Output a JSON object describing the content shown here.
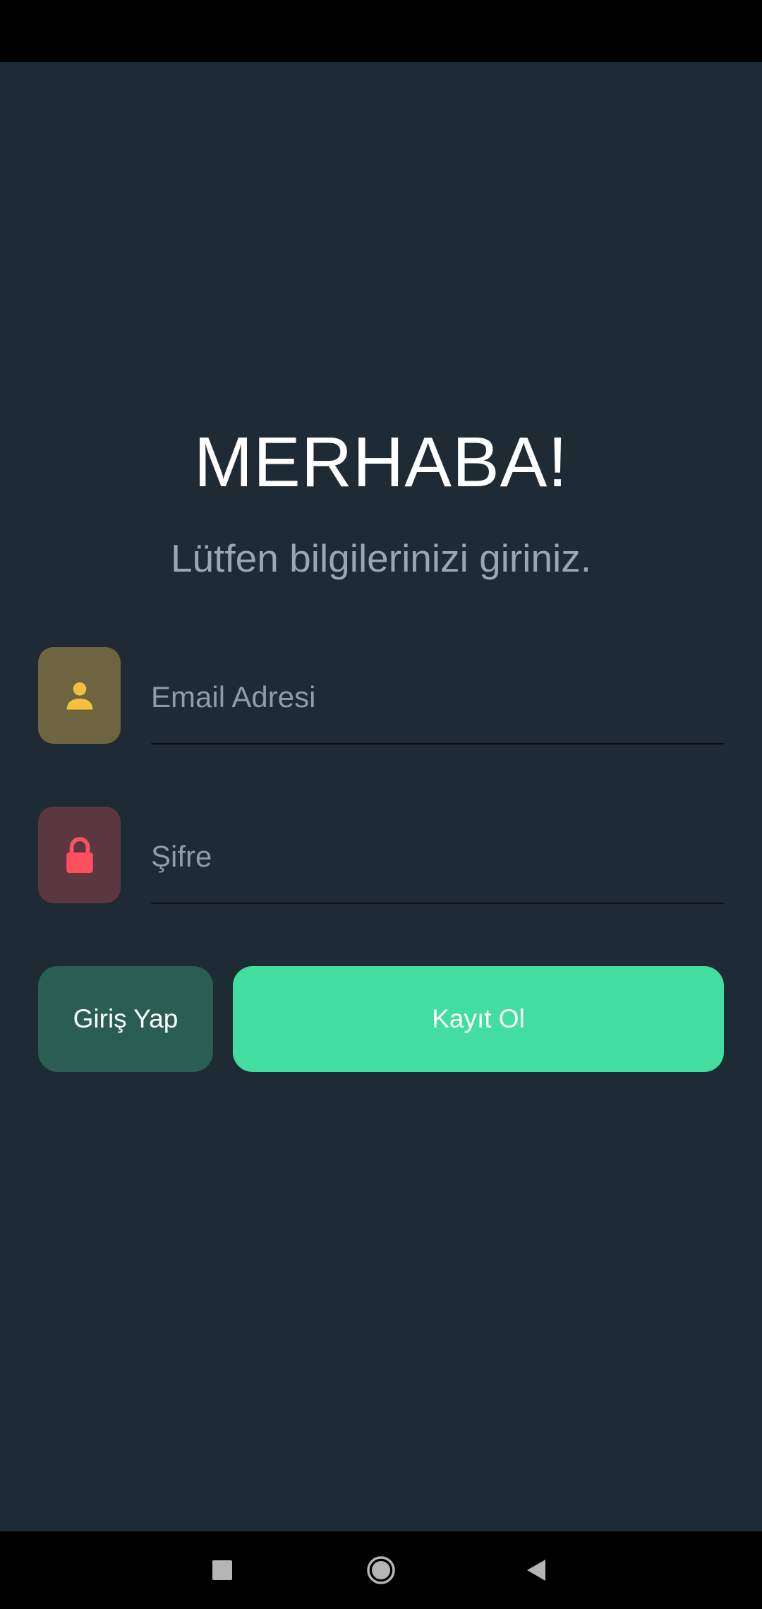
{
  "greeting": {
    "title": "MERHABA!",
    "subtitle": "Lütfen bilgilerinizi giriniz."
  },
  "form": {
    "email": {
      "placeholder": "Email Adresi",
      "value": "",
      "icon": "user-icon",
      "icon_color": "#f3bf3d"
    },
    "password": {
      "placeholder": "Şifre",
      "value": "",
      "icon": "lock-icon",
      "icon_color": "#ff4f5e"
    }
  },
  "actions": {
    "login_label": "Giriş Yap",
    "register_label": "Kayıt Ol"
  },
  "colors": {
    "background": "#1f2b34",
    "login_button": "#2a5e52",
    "register_button": "#41de9f"
  },
  "navigation": {
    "buttons": [
      "recents-icon",
      "home-icon",
      "back-icon"
    ]
  }
}
